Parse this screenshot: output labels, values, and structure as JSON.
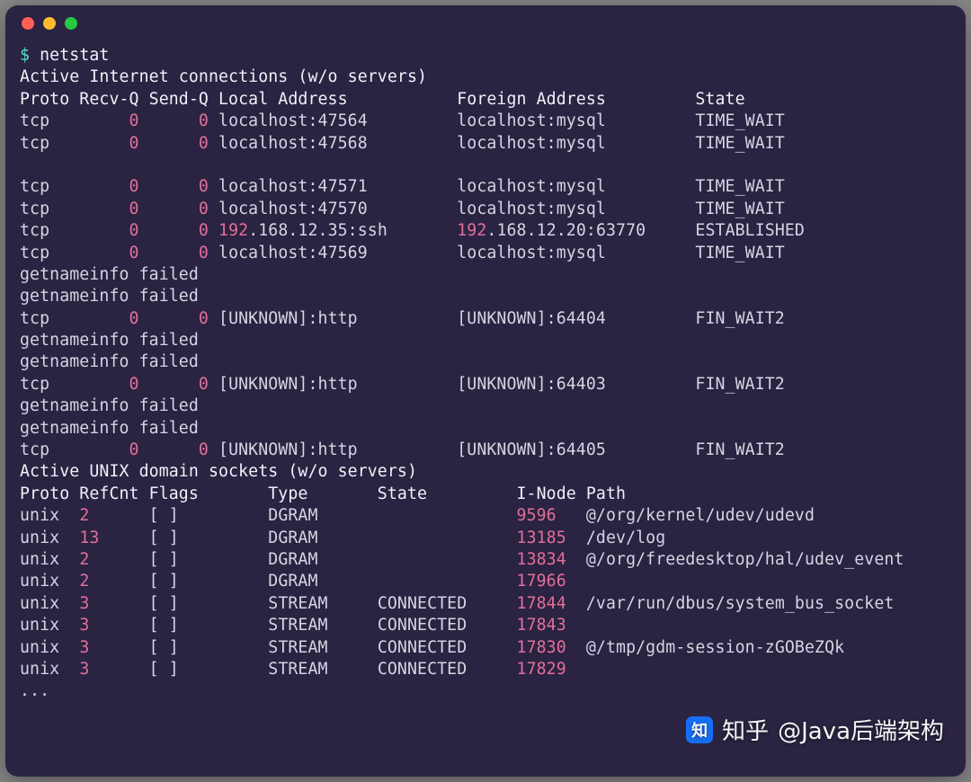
{
  "prompt_symbol": "$",
  "command": "netstat",
  "headers": {
    "internet_title": "Active Internet connections (w/o servers)",
    "internet_cols": "Proto Recv-Q Send-Q Local Address           Foreign Address         State      ",
    "unix_title": "Active UNIX domain sockets (w/o servers)",
    "unix_cols": "Proto RefCnt Flags       Type       State         I-Node Path"
  },
  "fail_msg": "getnameinfo failed",
  "footer": "...",
  "inet_rows": [
    {
      "kind": "row",
      "proto": "tcp",
      "recvq": "0",
      "sendq": "0",
      "local": {
        "pre": "",
        "hl": "",
        "post": "localhost:47564"
      },
      "foreign": {
        "pre": "",
        "hl": "",
        "post": "localhost:mysql"
      },
      "state": {
        "text": "TIME_WAIT",
        "cls": ""
      }
    },
    {
      "kind": "row",
      "proto": "tcp",
      "recvq": "0",
      "sendq": "0",
      "local": {
        "pre": "",
        "hl": "",
        "post": "localhost:47568"
      },
      "foreign": {
        "pre": "",
        "hl": "",
        "post": "localhost:mysql"
      },
      "state": {
        "text": "TIME_WAIT",
        "cls": ""
      }
    },
    {
      "kind": "blank"
    },
    {
      "kind": "row",
      "proto": "tcp",
      "recvq": "0",
      "sendq": "0",
      "local": {
        "pre": "",
        "hl": "",
        "post": "localhost:47571"
      },
      "foreign": {
        "pre": "",
        "hl": "",
        "post": "localhost:mysql"
      },
      "state": {
        "text": "TIME_WAIT",
        "cls": ""
      }
    },
    {
      "kind": "row",
      "proto": "tcp",
      "recvq": "0",
      "sendq": "0",
      "local": {
        "pre": "",
        "hl": "",
        "post": "localhost:47570"
      },
      "foreign": {
        "pre": "",
        "hl": "",
        "post": "localhost:mysql"
      },
      "state": {
        "text": "TIME_WAIT",
        "cls": ""
      }
    },
    {
      "kind": "row",
      "proto": "tcp",
      "recvq": "0",
      "sendq": "0",
      "local": {
        "pre": "",
        "hl": "192",
        "post": ".168.12.35:ssh"
      },
      "foreign": {
        "pre": "",
        "hl": "192",
        "post": ".168.12.20:63770"
      },
      "state": {
        "text": "ESTABLISHED",
        "cls": ""
      }
    },
    {
      "kind": "row",
      "proto": "tcp",
      "recvq": "0",
      "sendq": "0",
      "local": {
        "pre": "",
        "hl": "",
        "post": "localhost:47569"
      },
      "foreign": {
        "pre": "",
        "hl": "",
        "post": "localhost:mysql"
      },
      "state": {
        "text": "TIME_WAIT",
        "cls": ""
      }
    },
    {
      "kind": "fail"
    },
    {
      "kind": "fail"
    },
    {
      "kind": "row",
      "proto": "tcp",
      "recvq": "0",
      "sendq": "0",
      "local": {
        "pre": "[UNKNOWN]:http",
        "hl": "",
        "post": ""
      },
      "foreign": {
        "pre": "[UNKNOWN]:64404",
        "hl": "",
        "post": ""
      },
      "state": {
        "text": "FIN_WAIT2",
        "cls": ""
      }
    },
    {
      "kind": "fail"
    },
    {
      "kind": "fail"
    },
    {
      "kind": "row",
      "proto": "tcp",
      "recvq": "0",
      "sendq": "0",
      "local": {
        "pre": "[UNKNOWN]:http",
        "hl": "",
        "post": ""
      },
      "foreign": {
        "pre": "[UNKNOWN]:64403",
        "hl": "",
        "post": ""
      },
      "state": {
        "text": "FIN_WAIT2",
        "cls": ""
      }
    },
    {
      "kind": "fail"
    },
    {
      "kind": "fail"
    },
    {
      "kind": "row",
      "proto": "tcp",
      "recvq": "0",
      "sendq": "0",
      "local": {
        "pre": "[UNKNOWN]:http",
        "hl": "",
        "post": ""
      },
      "foreign": {
        "pre": "[UNKNOWN]:64405",
        "hl": "",
        "post": ""
      },
      "state": {
        "text": "FIN_WAIT2",
        "cls": ""
      }
    }
  ],
  "unix_rows": [
    {
      "proto": "unix",
      "refcnt": "2",
      "flags": "[ ]",
      "type": "DGRAM",
      "state": "",
      "inode": "9596",
      "path": "@/org/kernel/udev/udevd"
    },
    {
      "proto": "unix",
      "refcnt": "13",
      "flags": "[ ]",
      "type": "DGRAM",
      "state": "",
      "inode": "13185",
      "path": "/dev/log"
    },
    {
      "proto": "unix",
      "refcnt": "2",
      "flags": "[ ]",
      "type": "DGRAM",
      "state": "",
      "inode": "13834",
      "path": "@/org/freedesktop/hal/udev_event"
    },
    {
      "proto": "unix",
      "refcnt": "2",
      "flags": "[ ]",
      "type": "DGRAM",
      "state": "",
      "inode": "17966",
      "path": ""
    },
    {
      "proto": "unix",
      "refcnt": "3",
      "flags": "[ ]",
      "type": "STREAM",
      "state": "CONNECTED",
      "inode": "17844",
      "path": "/var/run/dbus/system_bus_socket"
    },
    {
      "proto": "unix",
      "refcnt": "3",
      "flags": "[ ]",
      "type": "STREAM",
      "state": "CONNECTED",
      "inode": "17843",
      "path": ""
    },
    {
      "proto": "unix",
      "refcnt": "3",
      "flags": "[ ]",
      "type": "STREAM",
      "state": "CONNECTED",
      "inode": "17830",
      "path": "@/tmp/gdm-session-zGOBeZQk"
    },
    {
      "proto": "unix",
      "refcnt": "3",
      "flags": "[ ]",
      "type": "STREAM",
      "state": "CONNECTED",
      "inode": "17829",
      "path": ""
    }
  ],
  "watermark": {
    "prefix": "知乎",
    "handle": "@Java后端架构",
    "logo_letter": "知"
  }
}
